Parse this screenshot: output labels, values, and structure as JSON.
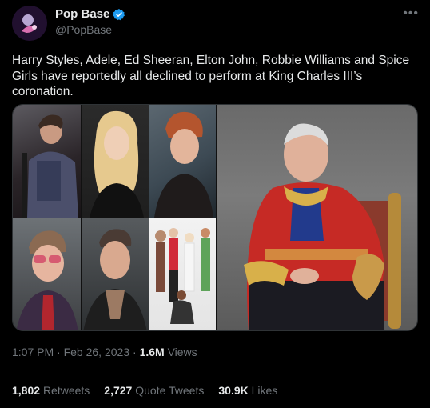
{
  "author": {
    "display_name": "Pop Base",
    "handle": "@PopBase",
    "verified_badge_color": "#1d9bf0"
  },
  "more_icon": "more-options-icon",
  "tweet": {
    "text": "Harry Styles, Adele, Ed Sheeran, Elton John, Robbie Williams and Spice Girls have reportedly all declined to perform at King Charles III’s coronation."
  },
  "meta": {
    "time": "1:07 PM",
    "date": "Feb 26, 2023",
    "views_count": "1.6M",
    "views_label": "Views"
  },
  "stats": {
    "retweets": {
      "count": "1,802",
      "label": "Retweets"
    },
    "quotes": {
      "count": "2,727",
      "label": "Quote Tweets"
    },
    "likes": {
      "count": "30.9K",
      "label": "Likes"
    }
  },
  "colors": {
    "background": "#000000",
    "text_primary": "#e7e9ea",
    "text_secondary": "#71767b",
    "border": "#2f3336",
    "accent": "#1d9bf0"
  }
}
